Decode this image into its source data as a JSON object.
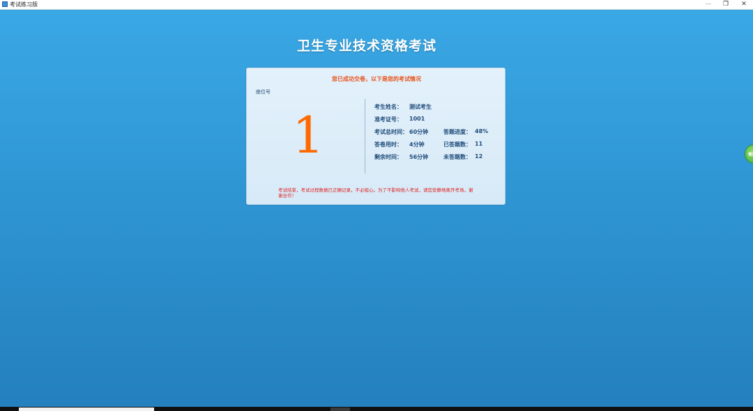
{
  "window": {
    "title": "考试练习版",
    "minimize_glyph": "—",
    "maximize_glyph": "❐",
    "close_glyph": "✕"
  },
  "page": {
    "title": "卫生专业技术资格考试"
  },
  "card": {
    "header": "您已成功交卷，以下是您的考试情况",
    "seat_label": "座位号",
    "seat_number": "1",
    "info": {
      "name_label": "考生姓名：",
      "name_value": "测试考生",
      "id_label": "准考证号：",
      "id_value": "1001",
      "total_time_label": "考试总时间：",
      "total_time_value": "60分钟",
      "progress_label": "答题进度：",
      "progress_value": "48%",
      "used_time_label": "答卷用时：",
      "used_time_value": "4分钟",
      "answered_label": "已答题数：",
      "answered_value": "11",
      "remaining_time_label": "剩余时间：",
      "remaining_time_value": "56分钟",
      "unanswered_label": "未答题数：",
      "unanswered_value": "12"
    },
    "notice": "考试结束，考试过程数据已正确记录，不必担心。为了不影响他人考试，请您安静地离开考场，谢谢合作！"
  },
  "side_button": {
    "label": "帮助"
  },
  "colors": {
    "background_top": "#3aa9e6",
    "background_bottom": "#247fbd",
    "seat_number": "#ff6a00",
    "header_text": "#e8531a",
    "notice_text": "#e02020",
    "info_text": "#1f4c7a"
  }
}
